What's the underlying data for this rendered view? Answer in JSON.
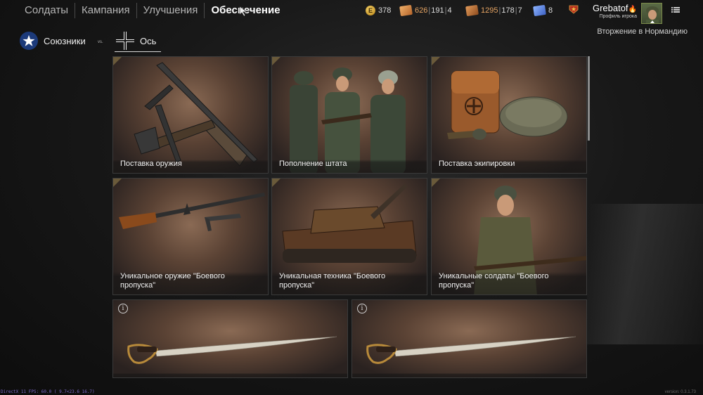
{
  "nav": {
    "items": [
      "Солдаты",
      "Кампания",
      "Улучшения",
      "Обеспечение"
    ],
    "active_index": 3
  },
  "resources": {
    "gold": "378",
    "orange_tickets": {
      "a": "626",
      "b": "191",
      "c": "4"
    },
    "brown_tickets": {
      "a": "1295",
      "b": "178",
      "c": "7"
    },
    "blue_tickets": "8"
  },
  "player": {
    "name": "Grebatof",
    "profile_label": "Профиль игрока"
  },
  "campaign_title": "Вторжение в Нормандию",
  "factions": {
    "allies_label": "Союзники",
    "vs_label": "vs.",
    "axis_label": "Ось",
    "selected": "axis"
  },
  "cards": [
    {
      "caption": "Поставка оружия",
      "icon": "weapons-image"
    },
    {
      "caption": "Пополнение штата",
      "icon": "soldiers-image"
    },
    {
      "caption": "Поставка экипировки",
      "icon": "equipment-image"
    },
    {
      "caption": "Уникальное оружие \"Боевого пропуска\"",
      "icon": "rifle-image"
    },
    {
      "caption": "Уникальная техника \"Боевого пропуска\"",
      "icon": "tank-image"
    },
    {
      "caption": "Уникальные солдаты \"Боевого пропуска\"",
      "icon": "soldier-image"
    },
    {
      "caption": "",
      "icon": "sabre-image",
      "info_icon": "i"
    },
    {
      "caption": "",
      "icon": "sabre-image",
      "info_icon": "i"
    }
  ],
  "footer": {
    "fps": "DirectX 11 FPS: 60.0 ( 9.7<23.6 16.7)",
    "version": "version: 0.3.1.73"
  },
  "colors": {
    "accent_orange": "#e6a463",
    "allies_blue": "#1c3a7a",
    "card_bg": "#5a4234"
  }
}
